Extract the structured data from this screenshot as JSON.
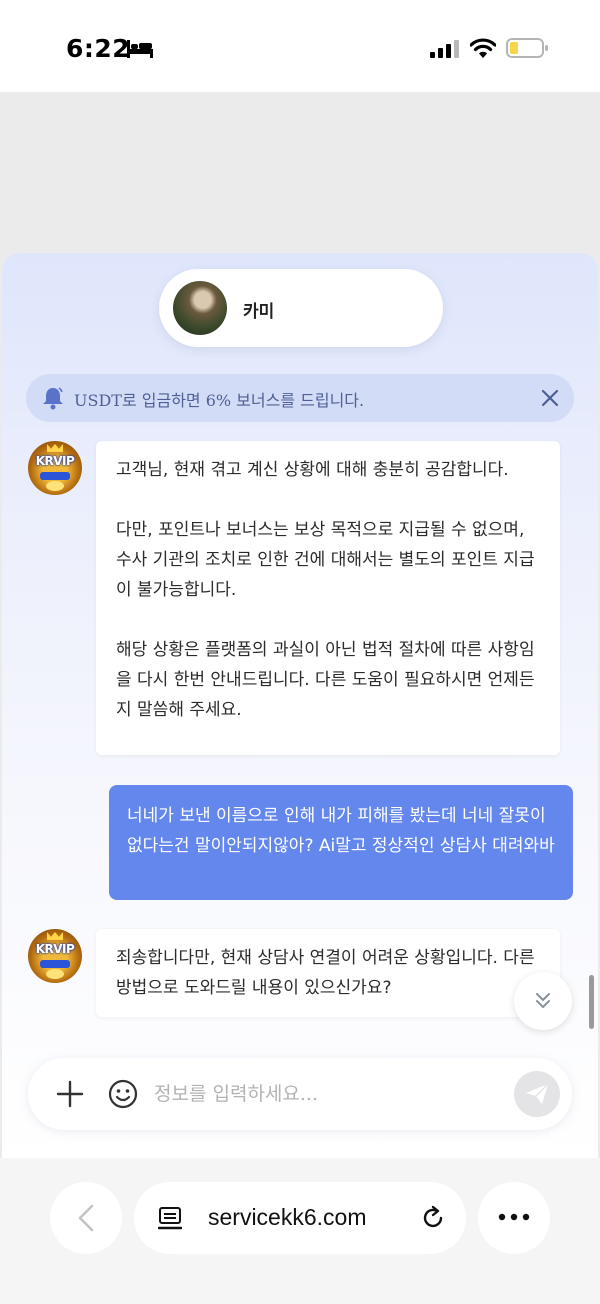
{
  "status_bar": {
    "time": "6:22"
  },
  "chat": {
    "agent_name": "카미",
    "notice": "USDT로 입금하면 6% 보너스를 드립니다.",
    "messages": [
      {
        "sender": "bot",
        "paragraphs": [
          "고객님, 현재 겪고 계신 상황에 대해 충분히 공감합니다.",
          "다만, 포인트나 보너스는 보상 목적으로 지급될 수 없으며, 수사 기관의 조치로 인한 건에 대해서는 별도의 포인트 지급이 불가능합니다.",
          "해당 상황은 플랫폼의 과실이 아닌 법적 절차에 따른 사항임을 다시 한번 안내드립니다. 다른 도움이 필요하시면 언제든지 말씀해 주세요."
        ]
      },
      {
        "sender": "user",
        "text": "너네가 보낸 이름으로 인해 내가 피해를 봤는데 너네 잘못이없다는건 말이안되지않아? Ai말고 정상적인 상담사 대려와바"
      },
      {
        "sender": "bot",
        "paragraphs": [
          "죄송합니다만, 현재 상담사 연결이 어려운 상황입니다. 다른 방법으로 도와드릴 내용이 있으신가요?"
        ]
      }
    ],
    "bot_avatar_label": "KRVIP",
    "input_placeholder": "정보를 입력하세요..."
  },
  "browser": {
    "url": "servicekk6.com"
  },
  "icons": {
    "status": [
      "bed-icon",
      "signal-icon",
      "wifi-icon",
      "battery-icon"
    ],
    "chat": [
      "bell-icon",
      "close-icon",
      "chevrons-down-icon",
      "plus-icon",
      "emoji-icon",
      "send-icon"
    ],
    "browser": [
      "back-icon",
      "site-icon",
      "reload-icon",
      "more-icon"
    ]
  },
  "colors": {
    "user_bubble": "#6487ee",
    "notice_bg": "#d2dcf7",
    "notice_text": "#4e5f94",
    "battery_fill": "#f7d64a"
  }
}
